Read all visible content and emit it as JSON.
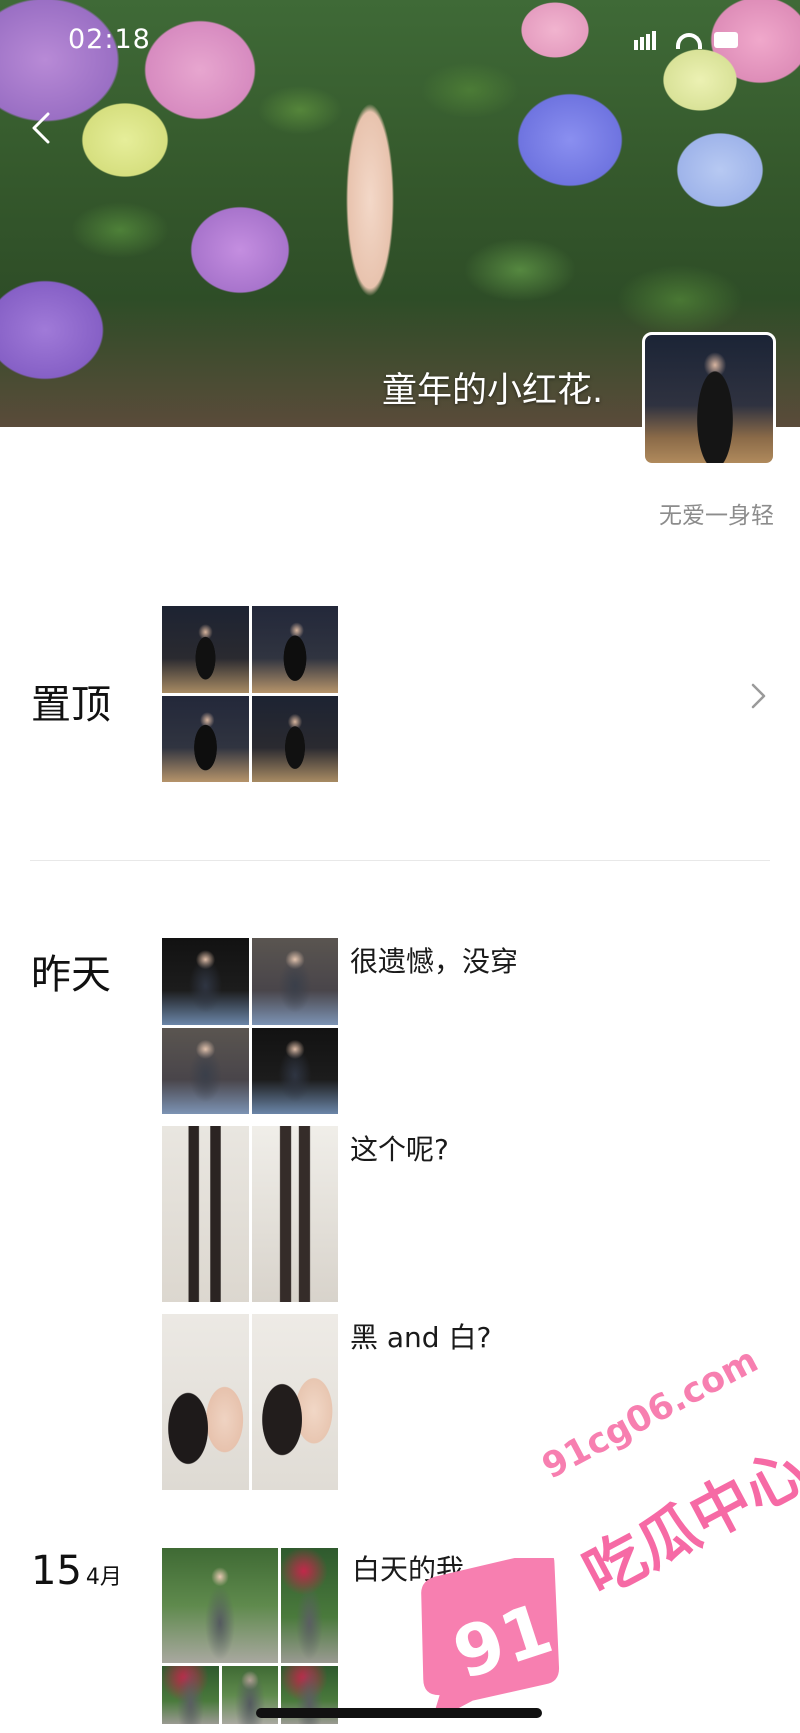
{
  "status_bar": {
    "time": "02:18"
  },
  "cover": {
    "caption": "童年的小红花."
  },
  "profile": {
    "username": "无爱一身轻"
  },
  "pinned": {
    "label": "置顶"
  },
  "posts": [
    {
      "date": "昨天",
      "text": "很遗憾，没穿"
    },
    {
      "date": "",
      "text": "这个呢?"
    },
    {
      "date": "",
      "text": "黑 and 白?"
    },
    {
      "date_day": "15",
      "date_month": "4月",
      "text": "白天的我"
    }
  ],
  "watermark": {
    "domain": "91cg06.com",
    "brand": "吃瓜中心",
    "logo": "91"
  }
}
